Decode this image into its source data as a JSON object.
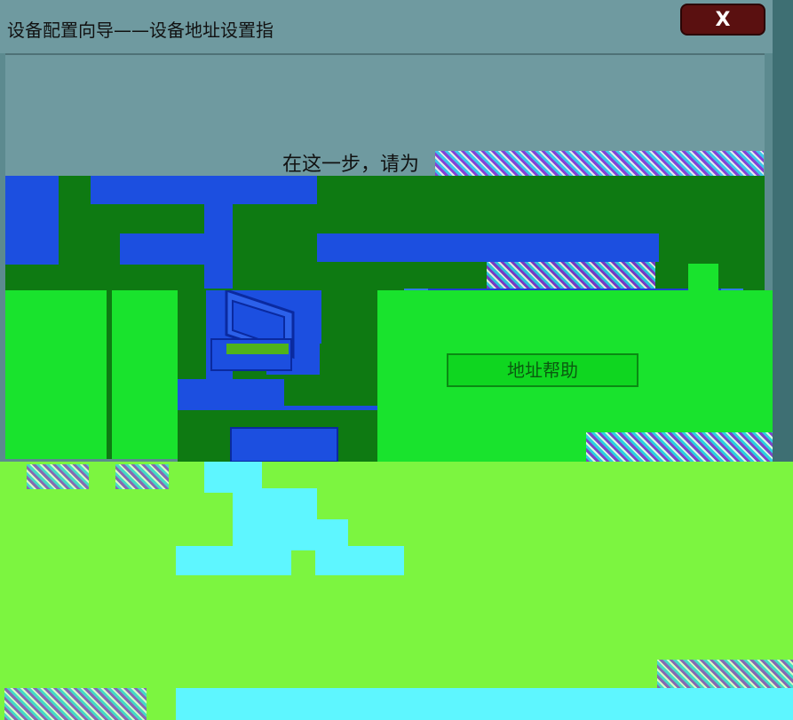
{
  "window": {
    "title": "设备配置向导——设备地址设置指",
    "close_symbol": "X"
  },
  "content": {
    "instruction": "在这一步，请为",
    "address_help_button": "地址帮助"
  },
  "icons": {
    "close": "close-icon",
    "device": "computer-device-icon"
  }
}
